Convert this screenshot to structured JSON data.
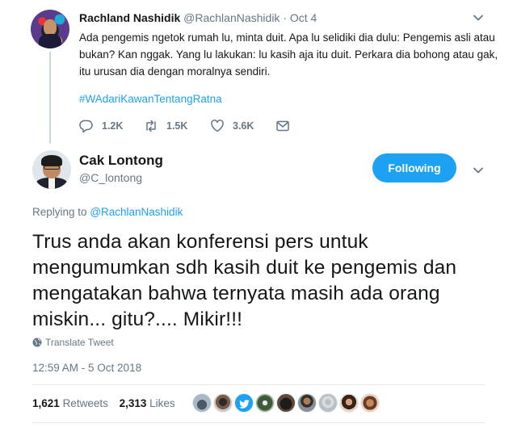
{
  "parent_tweet": {
    "name": "Rachland Nashidik",
    "handle": "@RachlanNashidik",
    "separator": "·",
    "date": "Oct 4",
    "text": "Ada pengemis ngetok rumah lu, minta duit. Apa lu selidiki dia dulu: Pengemis asli atau bukan? Kan nggak. Yang lu lakukan: lu kasih aja itu duit. Perkara dia bohong atau gak, itu urusan dia dengan moralnya sendiri.",
    "hashtag": "#WAdariKawanTentangRatna",
    "actions": {
      "replies": "1.2K",
      "retweets": "1.5K",
      "likes": "3.6K"
    }
  },
  "main_tweet": {
    "name": "Cak Lontong",
    "handle": "@C_lontong",
    "follow_label": "Following",
    "replying_prefix": "Replying to",
    "replying_handle": "@RachlanNashidik",
    "text": "Trus anda akan konferensi pers untuk mengumumkan sdh kasih duit ke pengemis dan mengatakan bahwa ternyata masih ada orang miskin... gitu?.... Mikir!!!",
    "translate_label": "Translate Tweet",
    "timestamp": "12:59 AM - 5 Oct 2018",
    "retweets_count": "1,621",
    "retweets_label": "Retweets",
    "likes_count": "2,313",
    "likes_label": "Likes"
  },
  "colors": {
    "accent": "#1da1f2",
    "muted": "#657786",
    "text": "#14171a"
  },
  "icons": {
    "reply": "reply-icon",
    "retweet": "retweet-icon",
    "like": "heart-icon",
    "dm": "envelope-icon",
    "more": "chevron-down-icon",
    "translate": "globe-icon"
  }
}
